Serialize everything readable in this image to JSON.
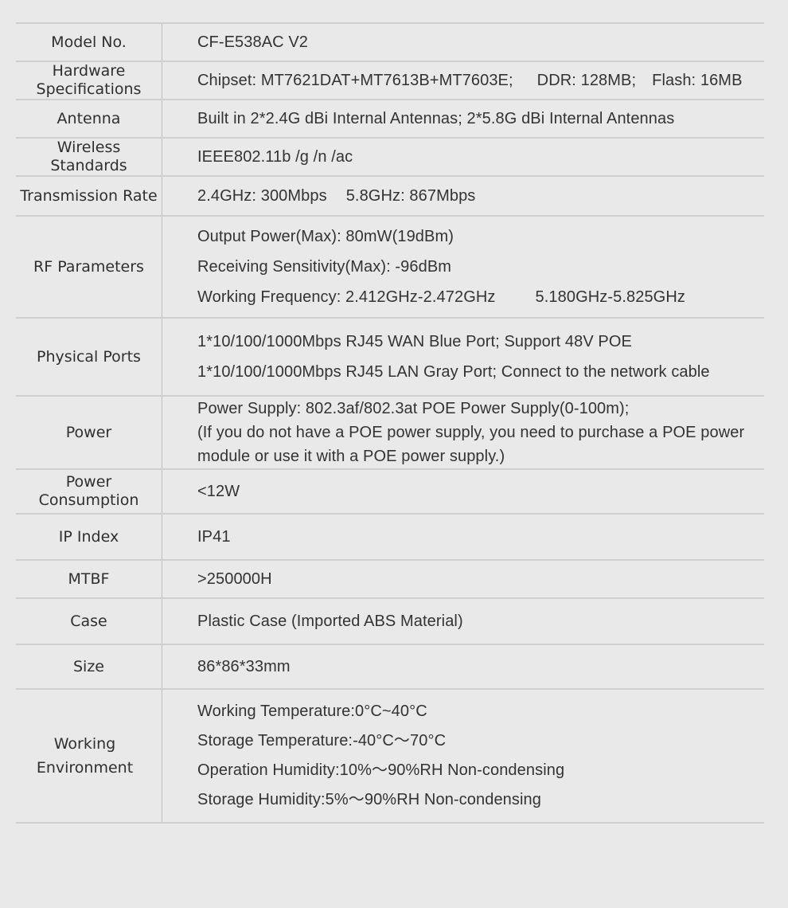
{
  "rows": [
    {
      "label": "Model No.",
      "values": [
        "CF-E538AC V2"
      ]
    },
    {
      "label": "Hardware Specifications",
      "values": [
        "Chipset: MT7621DAT+MT7613B+MT7603E;",
        "DDR: 128MB;",
        "Flash: 16MB"
      ]
    },
    {
      "label": "Antenna",
      "values": [
        "Built in 2*2.4G dBi Internal Antennas; 2*5.8G dBi Internal Antennas"
      ]
    },
    {
      "label": "Wireless Standards",
      "values": [
        "IEEE802.11b /g /n /ac"
      ]
    },
    {
      "label": "Transmission Rate",
      "values": [
        "2.4GHz: 300Mbps",
        "5.8GHz: 867Mbps"
      ]
    },
    {
      "label": "RF Parameters",
      "values": [
        "Output Power(Max): 80mW(19dBm)",
        "Receiving Sensitivity(Max): -96dBm",
        "Working Frequency: 2.412GHz-2.472GHz",
        "5.180GHz-5.825GHz"
      ]
    },
    {
      "label": "Physical Ports",
      "values": [
        "1*10/100/1000Mbps RJ45 WAN Blue Port; Support 48V POE",
        "1*10/100/1000Mbps RJ45 LAN Gray Port; Connect to the network cable"
      ]
    },
    {
      "label": "Power",
      "values": [
        "Power Supply: 802.3af/802.3at POE Power Supply(0-100m);",
        "(If you do not have a POE power supply, you need to purchase a POE power module or use it with a POE power supply.)"
      ]
    },
    {
      "label": "Power Consumption",
      "values": [
        "<12W"
      ]
    },
    {
      "label": "IP Index",
      "values": [
        "IP41"
      ]
    },
    {
      "label": "MTBF",
      "values": [
        ">250000H"
      ]
    },
    {
      "label": "Case",
      "values": [
        "Plastic Case (Imported ABS Material)"
      ]
    },
    {
      "label": "Size",
      "values": [
        "86*86*33mm"
      ]
    },
    {
      "label": "Working Environment",
      "values": [
        "Working Temperature:0°C~40°C",
        "Storage Temperature:-40°C～70°C",
        "Operation Humidity:10%～90%RH Non-condensing",
        "Storage Humidity:5%～90%RH Non-condensing"
      ]
    }
  ]
}
